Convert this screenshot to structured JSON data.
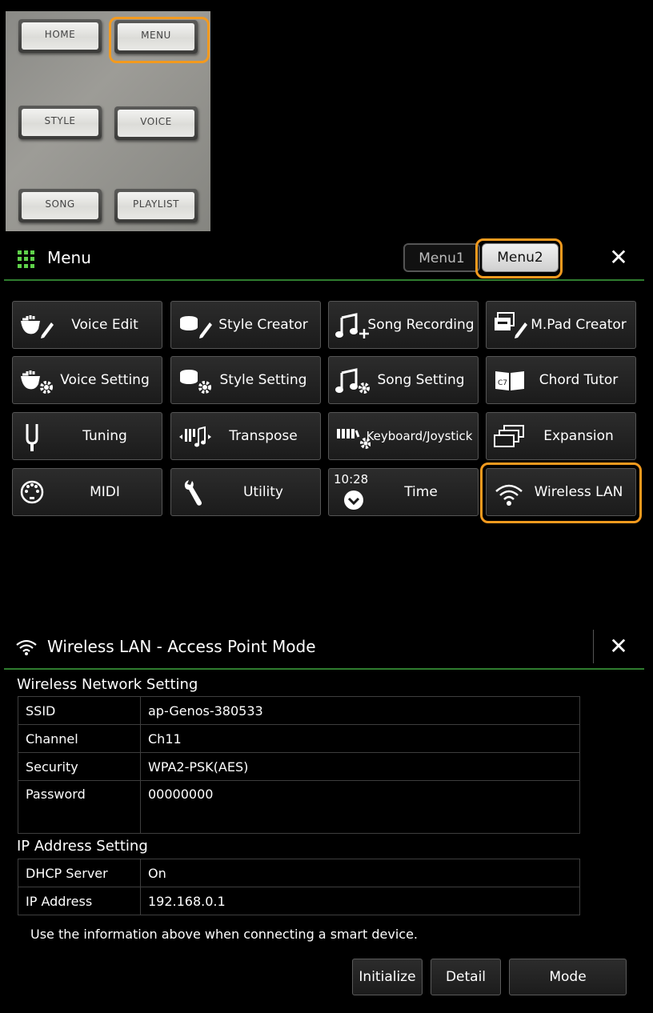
{
  "panel": {
    "buttons": [
      "HOME",
      "MENU",
      "STYLE",
      "VOICE",
      "SONG",
      "PLAYLIST"
    ]
  },
  "menu_window": {
    "title": "Menu",
    "tabs": [
      {
        "label": "Menu1",
        "selected": false
      },
      {
        "label": "Menu2",
        "selected": true
      }
    ],
    "close_icon": "close-icon",
    "items": [
      {
        "label": "Voice Edit",
        "icon": "voice-edit-icon"
      },
      {
        "label": "Style Creator",
        "icon": "style-creator-icon"
      },
      {
        "label": "Song Recording",
        "icon": "song-recording-icon"
      },
      {
        "label": "M.Pad Creator",
        "icon": "mpad-creator-icon"
      },
      {
        "label": "Voice Setting",
        "icon": "voice-setting-icon"
      },
      {
        "label": "Style Setting",
        "icon": "style-setting-icon"
      },
      {
        "label": "Song Setting",
        "icon": "song-setting-icon"
      },
      {
        "label": "Chord Tutor",
        "icon": "chord-tutor-icon",
        "icon_text": "C7"
      },
      {
        "label": "Tuning",
        "icon": "tuning-fork-icon"
      },
      {
        "label": "Transpose",
        "icon": "transpose-icon"
      },
      {
        "label": "Keyboard/Joystick",
        "icon": "keyboard-joystick-icon"
      },
      {
        "label": "Expansion",
        "icon": "expansion-icon"
      },
      {
        "label": "MIDI",
        "icon": "midi-icon"
      },
      {
        "label": "Utility",
        "icon": "wrench-icon"
      },
      {
        "label": "Time",
        "icon": "clock-icon",
        "icon_text": "10:28"
      },
      {
        "label": "Wireless LAN",
        "icon": "wifi-icon"
      }
    ]
  },
  "wlan_window": {
    "title": "Wireless LAN - Access Point Mode",
    "network_section": "Wireless Network Setting",
    "network_rows": [
      {
        "key": "SSID",
        "value": "ap-Genos-380533"
      },
      {
        "key": "Channel",
        "value": "Ch11"
      },
      {
        "key": "Security",
        "value": "WPA2-PSK(AES)"
      },
      {
        "key": "Password",
        "value": "00000000"
      }
    ],
    "ip_section": "IP Address Setting",
    "ip_rows": [
      {
        "key": "DHCP Server",
        "value": "On"
      },
      {
        "key": "IP Address",
        "value": "192.168.0.1"
      }
    ],
    "note": "Use the information above when connecting a smart device.",
    "buttons": {
      "initialize": "Initialize",
      "detail": "Detail",
      "mode": "Mode"
    }
  },
  "colors": {
    "highlight": "#f39a1e",
    "divider": "#2f7d2f",
    "grid_icon": "#5fd24a"
  }
}
